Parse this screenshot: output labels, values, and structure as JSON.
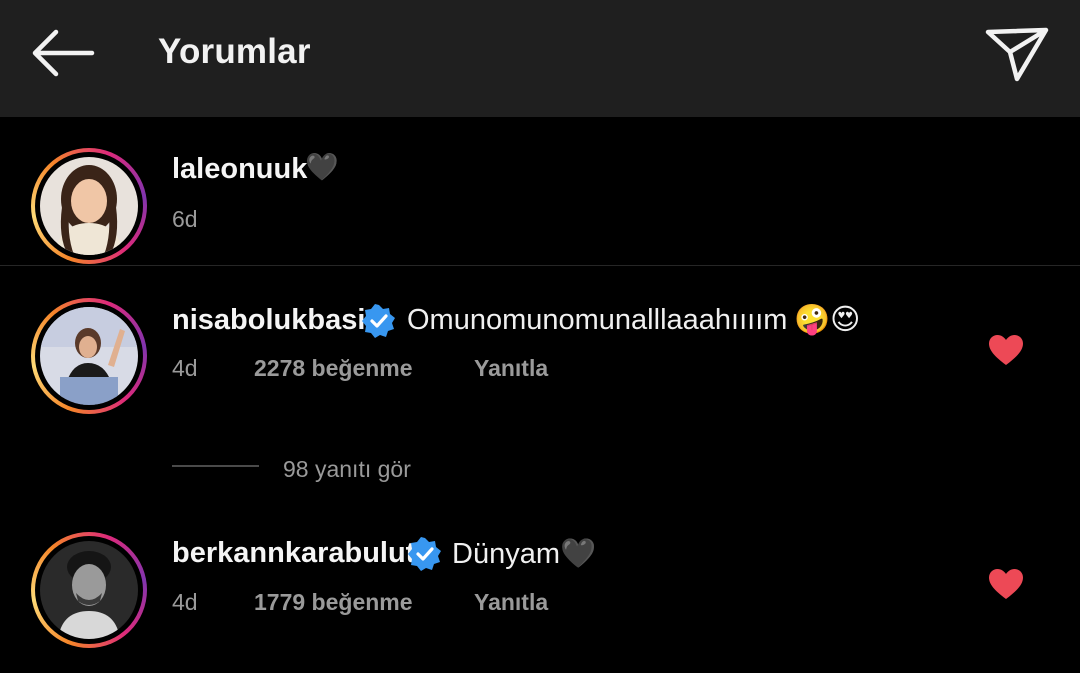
{
  "header": {
    "title": "Yorumlar",
    "back_icon": "arrow-left-icon",
    "share_icon": "paper-plane-icon"
  },
  "caption": {
    "username": "laleonuuk",
    "emoji": "🖤",
    "time": "6d"
  },
  "comments": [
    {
      "username": "nisabolukbasi",
      "verified": true,
      "text": "Omunomunomunalllaaahıııım",
      "emoji": "🤪😍",
      "time": "4d",
      "likes": "2278 beğenme",
      "reply": "Yanıtla",
      "liked": true
    },
    {
      "username": "berkannkarabulut",
      "verified": true,
      "text": "Dünyam🖤",
      "time": "4d",
      "likes": "1779 beğenme",
      "reply": "Yanıtla",
      "liked": true
    }
  ],
  "replies_toggle": "98 yanıtı gör",
  "colors": {
    "background": "#000000",
    "header": "#1f1f1f",
    "verified": "#3897f0",
    "heart": "#ed4956",
    "meta": "#9a9a9a"
  }
}
